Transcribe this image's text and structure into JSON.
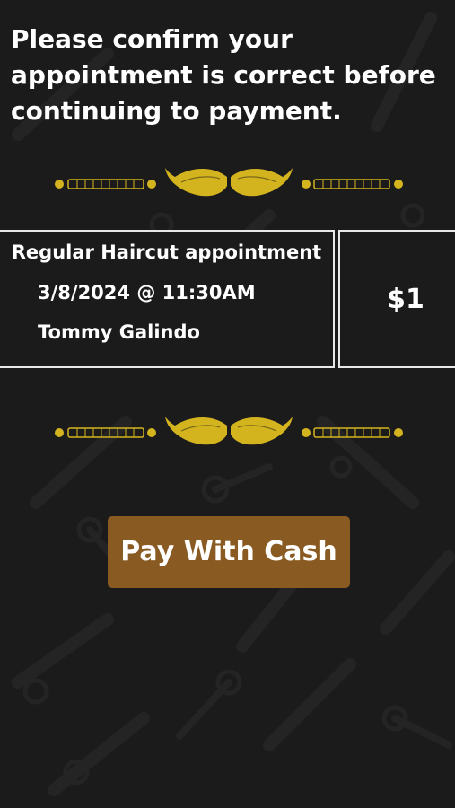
{
  "header": {
    "message": "Please confirm your appointment is correct before continuing to payment."
  },
  "appointment": {
    "service": "Regular Haircut appointment",
    "datetime": "3/8/2024 @ 11:30AM",
    "barber": "Tommy Galindo",
    "price": "$1"
  },
  "actions": {
    "pay_label": "Pay With Cash"
  },
  "colors": {
    "background": "#1b1b1b",
    "accent_gold": "#d4b41e",
    "button": "#8a5a23",
    "text": "#ffffff"
  }
}
